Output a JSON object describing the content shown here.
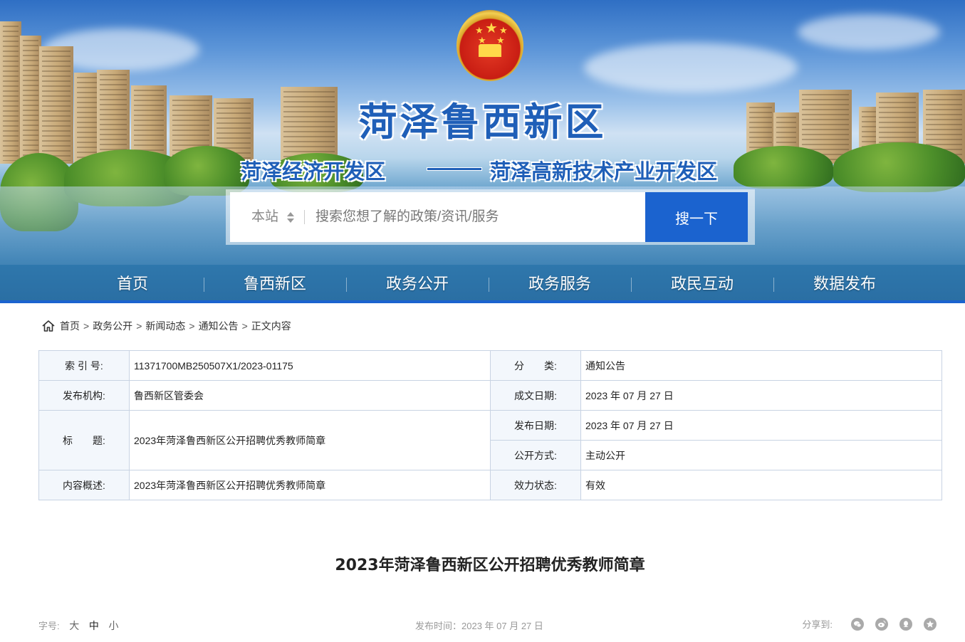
{
  "header": {
    "site_title": "菏泽鲁西新区",
    "subtitle_left": "菏泽经济开发区",
    "subtitle_right": "菏泽高新技术产业开发区"
  },
  "search": {
    "scope": "本站",
    "placeholder": "搜索您想了解的政策/资讯/服务",
    "button": "搜一下"
  },
  "nav": {
    "items": [
      "首页",
      "鲁西新区",
      "政务公开",
      "政务服务",
      "政民互动",
      "数据发布"
    ]
  },
  "breadcrumb": {
    "items": [
      "首页",
      "政务公开",
      "新闻动态",
      "通知公告",
      "正文内容"
    ],
    "separator": ">"
  },
  "meta": {
    "index_label": "索 引 号:",
    "index_value": "11371700MB250507X1/2023-01175",
    "category_label": "分　　类:",
    "category_value": "通知公告",
    "org_label": "发布机构:",
    "org_value": "鲁西新区管委会",
    "written_label": "成文日期:",
    "written_value": "2023 年 07 月 27 日",
    "title_label": "标　　题:",
    "title_value": "2023年菏泽鲁西新区公开招聘优秀教师简章",
    "published_label": "发布日期:",
    "published_value": "2023 年 07 月 27 日",
    "disclosure_label": "公开方式:",
    "disclosure_value": "主动公开",
    "summary_label": "内容概述:",
    "summary_value": "2023年菏泽鲁西新区公开招聘优秀教师简章",
    "status_label": "效力状态:",
    "status_value": "有效"
  },
  "article": {
    "title": "2023年菏泽鲁西新区公开招聘优秀教师简章",
    "font_size_label": "字号:",
    "font_sizes": [
      "大",
      "中",
      "小"
    ],
    "publish_time": "发布时间：2023 年 07 月 27 日",
    "share_label": "分享到:"
  },
  "icons": {
    "share": [
      "wechat-icon",
      "weibo-icon",
      "qq-icon",
      "qzone-icon"
    ]
  },
  "colors": {
    "brand_blue": "#1b63cf",
    "title_blue": "#1f5fb8",
    "table_label_bg": "#f3f7fc",
    "table_border": "#c8d3e3"
  }
}
